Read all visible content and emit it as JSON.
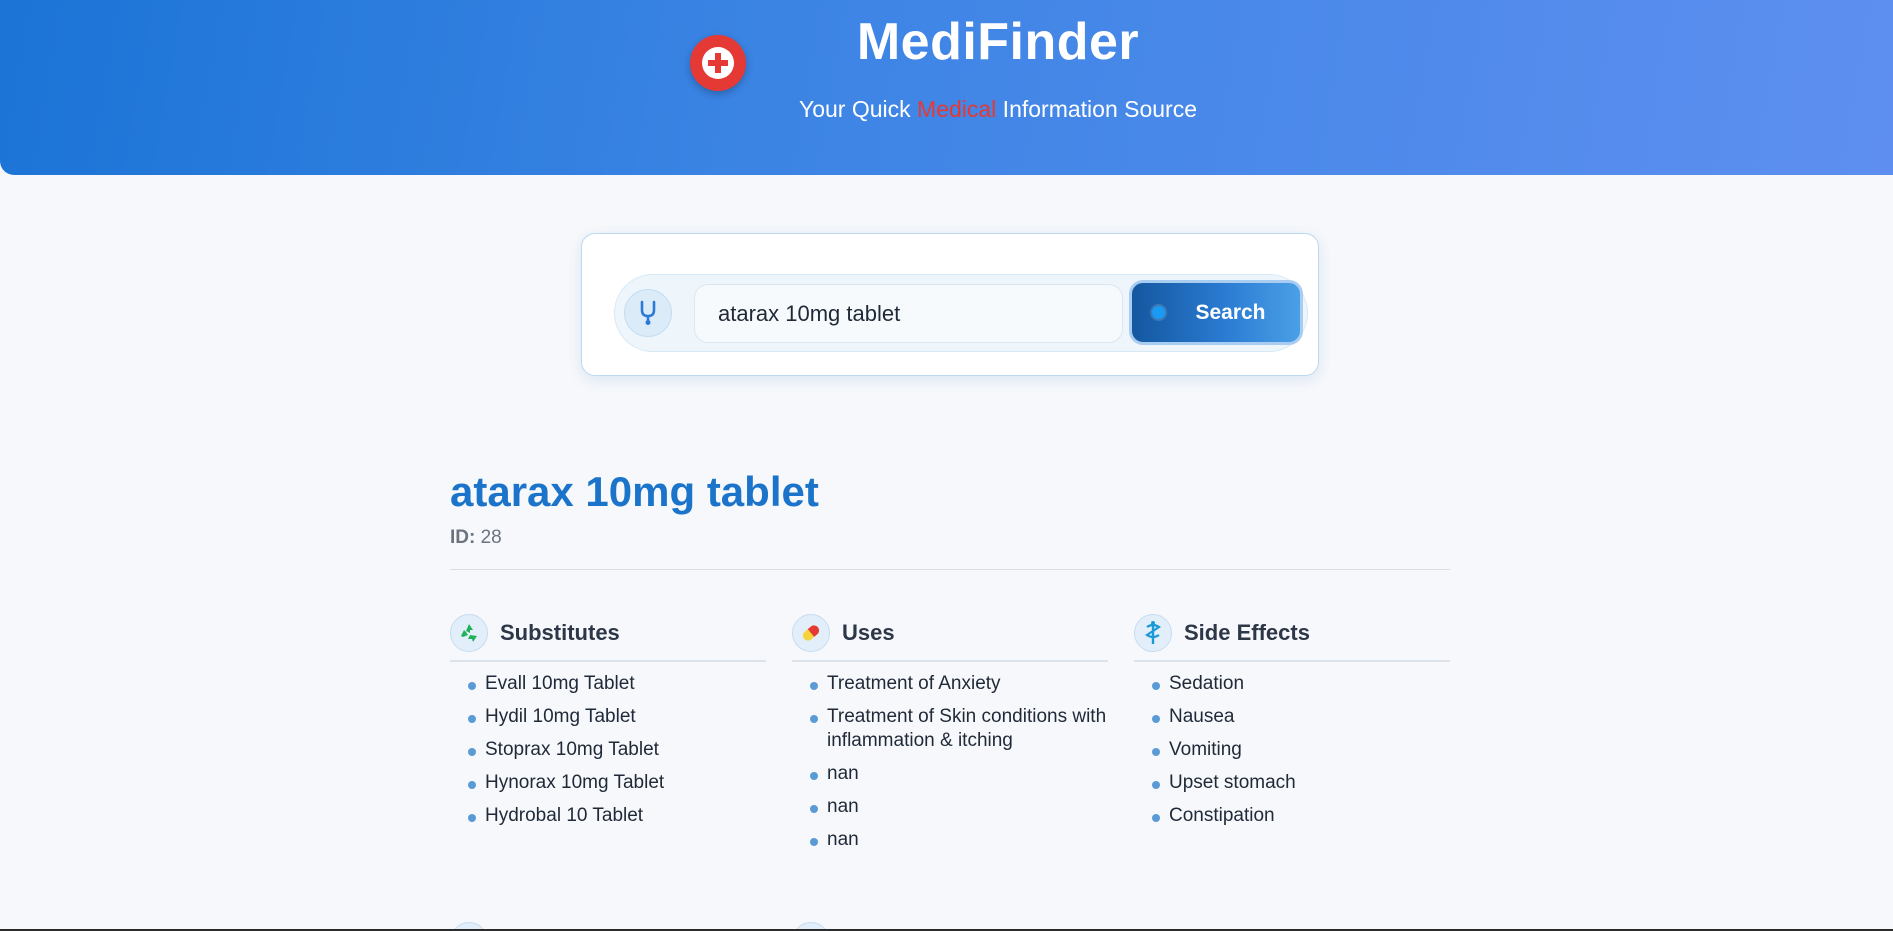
{
  "header": {
    "title": "MediFinder",
    "tagline_before": "Your Quick ",
    "tagline_accent": "Medical",
    "tagline_after": " Information Source"
  },
  "search": {
    "value": "atarax 10mg tablet",
    "button_label": "Search"
  },
  "result": {
    "title": "atarax 10mg tablet",
    "id_label": "ID:",
    "id_value": "28"
  },
  "sections": {
    "substitutes": {
      "title": "Substitutes",
      "icon": "recycle-icon",
      "items": [
        "Evall 10mg Tablet",
        "Hydil 10mg Tablet",
        "Stoprax 10mg Tablet",
        "Hynorax 10mg Tablet",
        "Hydrobal 10 Tablet"
      ]
    },
    "uses": {
      "title": "Uses",
      "icon": "pill-icon",
      "items": [
        "Treatment of Anxiety",
        "Treatment of Skin conditions with inflammation & itching",
        "nan",
        "nan",
        "nan"
      ]
    },
    "side_effects": {
      "title": "Side Effects",
      "icon": "caduceus-icon",
      "items": [
        "Sedation",
        "Nausea",
        "Vomiting",
        "Upset stomach",
        "Constipation"
      ]
    }
  },
  "colors": {
    "header_start": "#1b74d6",
    "header_end": "#5e8ff0",
    "accent_red": "#e53935",
    "title_blue": "#1b74c9"
  }
}
